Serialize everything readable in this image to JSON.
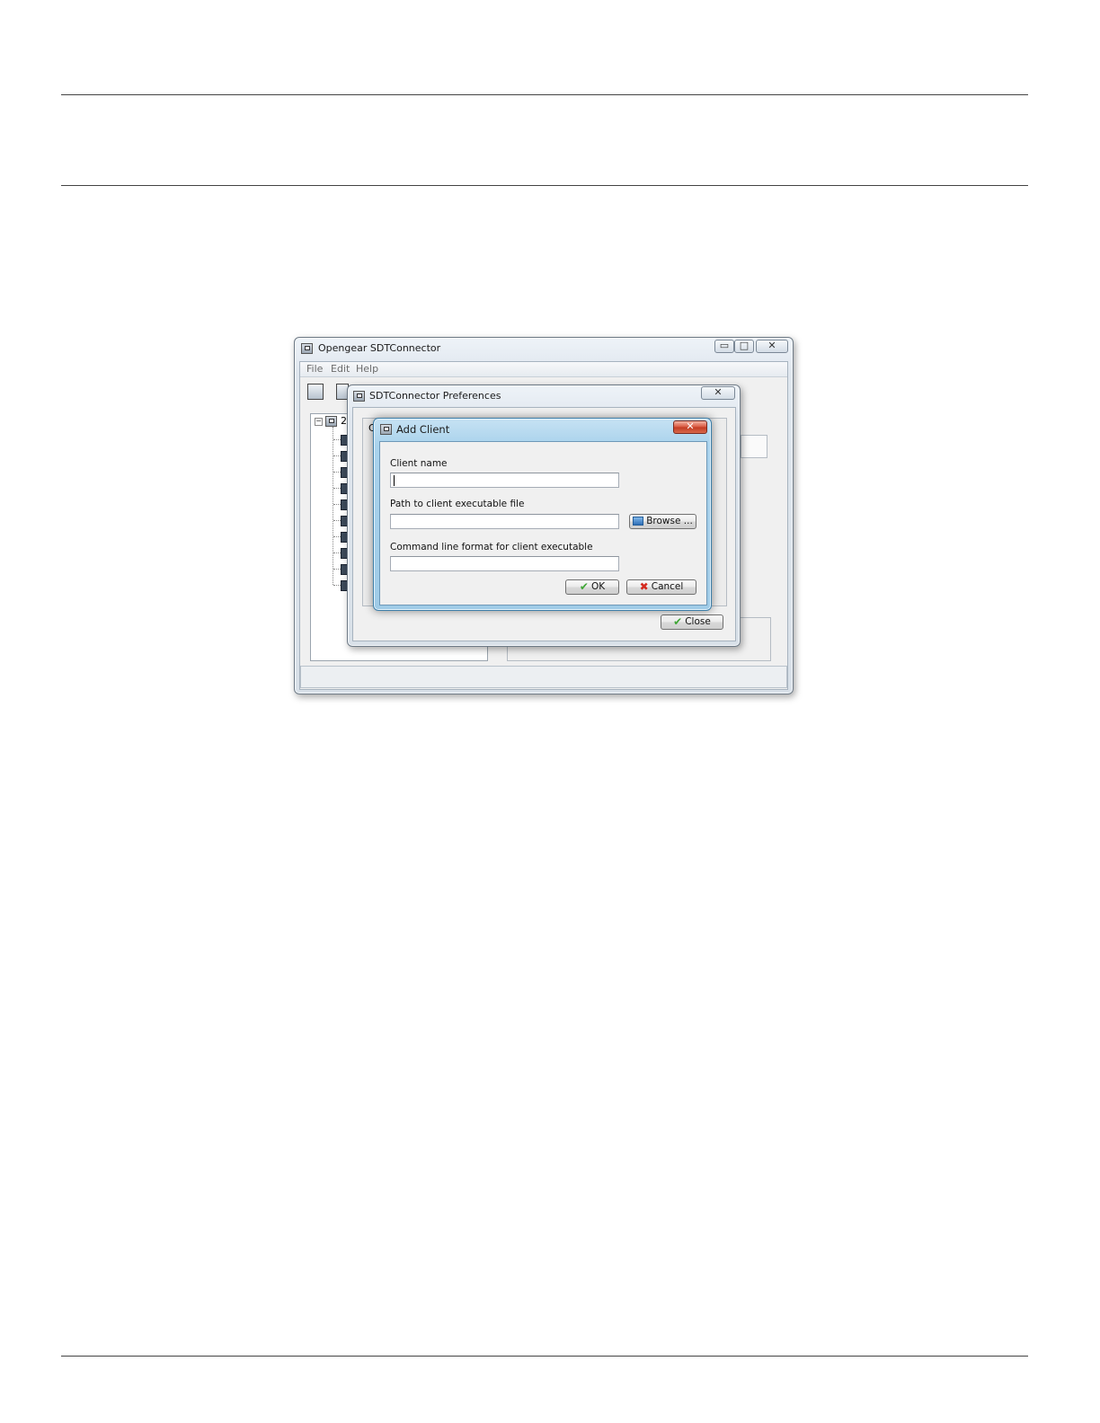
{
  "main_window": {
    "title": "Opengear SDTConnector",
    "menu": [
      "File",
      "Edit",
      "Help"
    ],
    "tree_root_label": "2",
    "window_controls": {
      "minimize": "▭",
      "maximize": "□",
      "close": "✕"
    }
  },
  "prefs_window": {
    "title": "SDTConnector Preferences",
    "tab_initial": "C",
    "close_glyph": "✕",
    "close_button": "Close"
  },
  "add_client_dialog": {
    "title": "Add Client",
    "close_glyph": "✕",
    "client_name_label": "Client name",
    "client_name_value": "",
    "path_label": "Path to client executable file",
    "path_value": "",
    "browse_button": "Browse ...",
    "cmdline_label": "Command line format for client executable",
    "cmdline_value": "",
    "ok_button": "OK",
    "cancel_button": "Cancel"
  },
  "icons": {
    "ok": "check-icon",
    "cancel": "red-x-icon",
    "browse": "folder-icon",
    "close": "check-icon"
  },
  "colors": {
    "ok_check": "#3fa535",
    "cancel_x": "#d42a1e",
    "dialog_frame": "#a9d2ec"
  }
}
